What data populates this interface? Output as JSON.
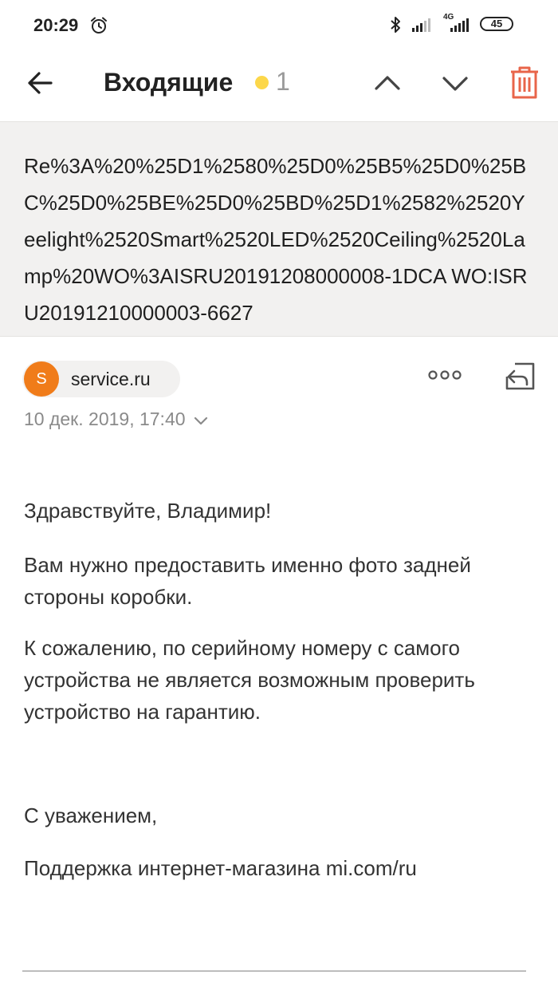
{
  "status_bar": {
    "time": "20:29",
    "network": "4G",
    "battery": "45"
  },
  "app_bar": {
    "folder_title": "Входящие",
    "unread_count": "1",
    "icons": [
      "back-arrow-icon",
      "chevron-up-icon",
      "chevron-down-icon",
      "trash-icon"
    ],
    "accent_color": "#e8654a",
    "unread_dot_color": "#fcd74a"
  },
  "subject": "Re%3A%20%25D1%2580%25D0%25B5%25D0%25BC%25D0%25BE%25D0%25BD%25D1%2582%2520Yeelight%2520Smart%2520LED%2520Ceiling%2520Lamp%20WO%3AISRU20191208000008-1DCA WO:ISRU20191210000003-6627",
  "sender": {
    "avatar_letter": "S",
    "name": "service.ru",
    "avatar_color": "#f07c1a"
  },
  "date": "10 дек. 2019, 17:40",
  "body": {
    "greeting": "Здравствуйте, Владимир!",
    "paragraph1": "Вам нужно предоставить именно фото задней стороны коробки.",
    "paragraph2": "К сожалению, по серийному номеру с самого устройства не является возможным проверить устройство на гарантию.",
    "closing": "С уважением,",
    "signature": "Поддержка интернет-магазина mi.com/ru"
  }
}
